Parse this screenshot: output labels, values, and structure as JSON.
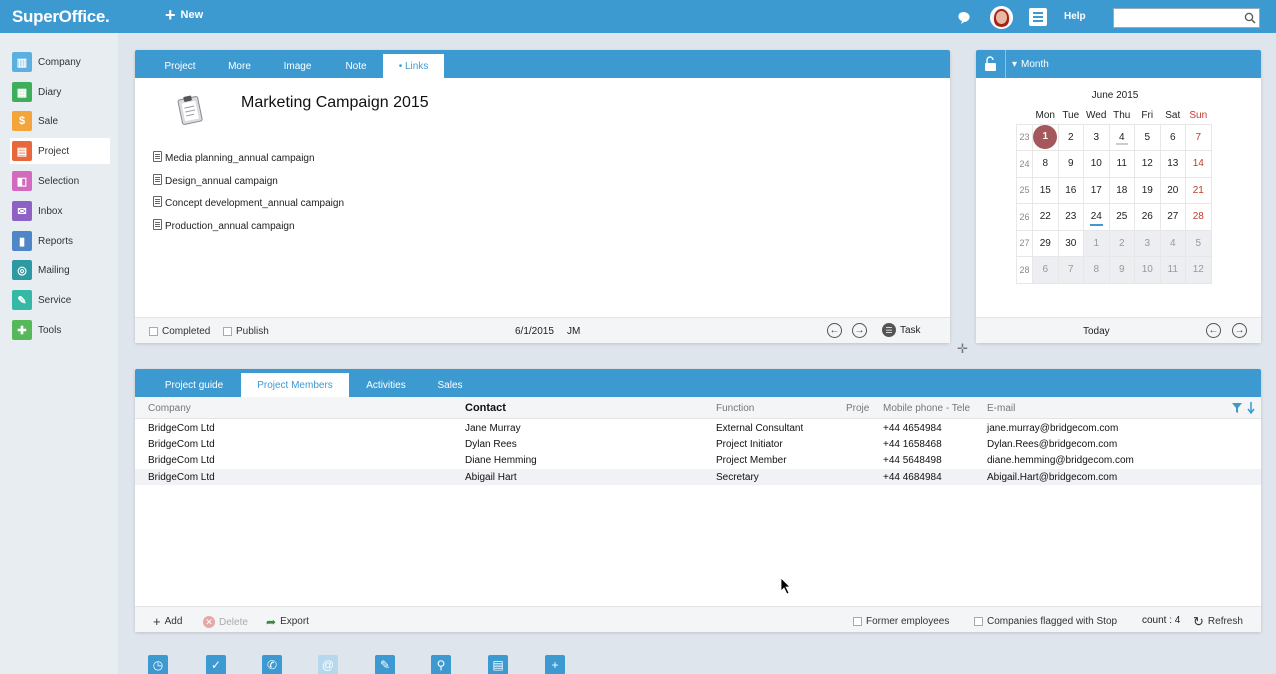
{
  "app": {
    "logo": "SuperOffice.",
    "new_label": "New",
    "help_label": "Help",
    "search_placeholder": ""
  },
  "sidebar": {
    "items": [
      {
        "label": "Company",
        "icon": "company-icon",
        "color": "#5bb0e0"
      },
      {
        "label": "Diary",
        "icon": "diary-icon",
        "color": "#3fae5a"
      },
      {
        "label": "Sale",
        "icon": "sale-icon",
        "color": "#f3a43b"
      },
      {
        "label": "Project",
        "icon": "project-icon",
        "color": "#e8673c"
      },
      {
        "label": "Selection",
        "icon": "selection-icon",
        "color": "#d46ac0"
      },
      {
        "label": "Inbox",
        "icon": "inbox-icon",
        "color": "#8d62c4"
      },
      {
        "label": "Reports",
        "icon": "reports-icon",
        "color": "#4e86c7"
      },
      {
        "label": "Mailing",
        "icon": "mailing-icon",
        "color": "#2d9aa3"
      },
      {
        "label": "Service",
        "icon": "service-icon",
        "color": "#35b8a6"
      },
      {
        "label": "Tools",
        "icon": "tools-icon",
        "color": "#56b85a"
      }
    ],
    "active": "Project"
  },
  "project": {
    "tabs": [
      "Project",
      "More",
      "Image",
      "Note",
      "• Links"
    ],
    "active_tab": "• Links",
    "title": "Marketing Campaign 2015",
    "links": [
      "Media planning_annual campaign",
      "Design_annual campaign",
      "Concept development_annual campaign",
      "Production_annual campaign"
    ],
    "footer": {
      "completed_label": "Completed",
      "publish_label": "Publish",
      "date": "6/1/2015",
      "owner": "JM",
      "task_label": "Task"
    }
  },
  "calendar": {
    "view_label": "Month",
    "month_title": "June 2015",
    "day_headers": [
      "Mon",
      "Tue",
      "Wed",
      "Thu",
      "Fri",
      "Sat",
      "Sun"
    ],
    "weeks": [
      {
        "wk": "23",
        "days": [
          "1",
          "2",
          "3",
          "4",
          "5",
          "6",
          "7"
        ]
      },
      {
        "wk": "24",
        "days": [
          "8",
          "9",
          "10",
          "11",
          "12",
          "13",
          "14"
        ]
      },
      {
        "wk": "25",
        "days": [
          "15",
          "16",
          "17",
          "18",
          "19",
          "20",
          "21"
        ]
      },
      {
        "wk": "26",
        "days": [
          "22",
          "23",
          "24",
          "25",
          "26",
          "27",
          "28"
        ]
      },
      {
        "wk": "27",
        "days": [
          "29",
          "30",
          "1",
          "2",
          "3",
          "4",
          "5"
        ]
      },
      {
        "wk": "28",
        "days": [
          "6",
          "7",
          "8",
          "9",
          "10",
          "11",
          "12"
        ]
      }
    ],
    "selected_day": "1",
    "today_label": "Today"
  },
  "members": {
    "tabs": [
      "Project guide",
      "Project Members",
      "Activities",
      "Sales"
    ],
    "active_tab": "Project Members",
    "columns": [
      "Company",
      "Contact",
      "Function",
      "Proje",
      "Mobile phone - Tele",
      "E-mail"
    ],
    "rows": [
      {
        "company": "BridgeCom Ltd",
        "contact": "Jane Murray",
        "function": "External Consultant",
        "phone": "+44 4654984",
        "email": "jane.murray@bridgecom.com"
      },
      {
        "company": "BridgeCom Ltd",
        "contact": "Dylan Rees",
        "function": "Project Initiator",
        "phone": "+44 1658468",
        "email": "Dylan.Rees@bridgecom.com"
      },
      {
        "company": "BridgeCom Ltd",
        "contact": "Diane Hemming",
        "function": "Project Member",
        "phone": "+44 5648498",
        "email": "diane.hemming@bridgecom.com"
      },
      {
        "company": "BridgeCom Ltd",
        "contact": "Abigail Hart",
        "function": "Secretary",
        "phone": "+44 4684984",
        "email": "Abigail.Hart@bridgecom.com"
      }
    ],
    "footer": {
      "add_label": "Add",
      "delete_label": "Delete",
      "export_label": "Export",
      "former_label": "Former employees",
      "stop_label": "Companies flagged with Stop",
      "count_label": "count : 4",
      "refresh_label": "Refresh"
    }
  },
  "bottom_toolbar": [
    "clock-icon",
    "check-icon",
    "phone-icon",
    "at-icon",
    "pencil-icon",
    "search-icon",
    "archive-icon",
    "plus-icon"
  ]
}
